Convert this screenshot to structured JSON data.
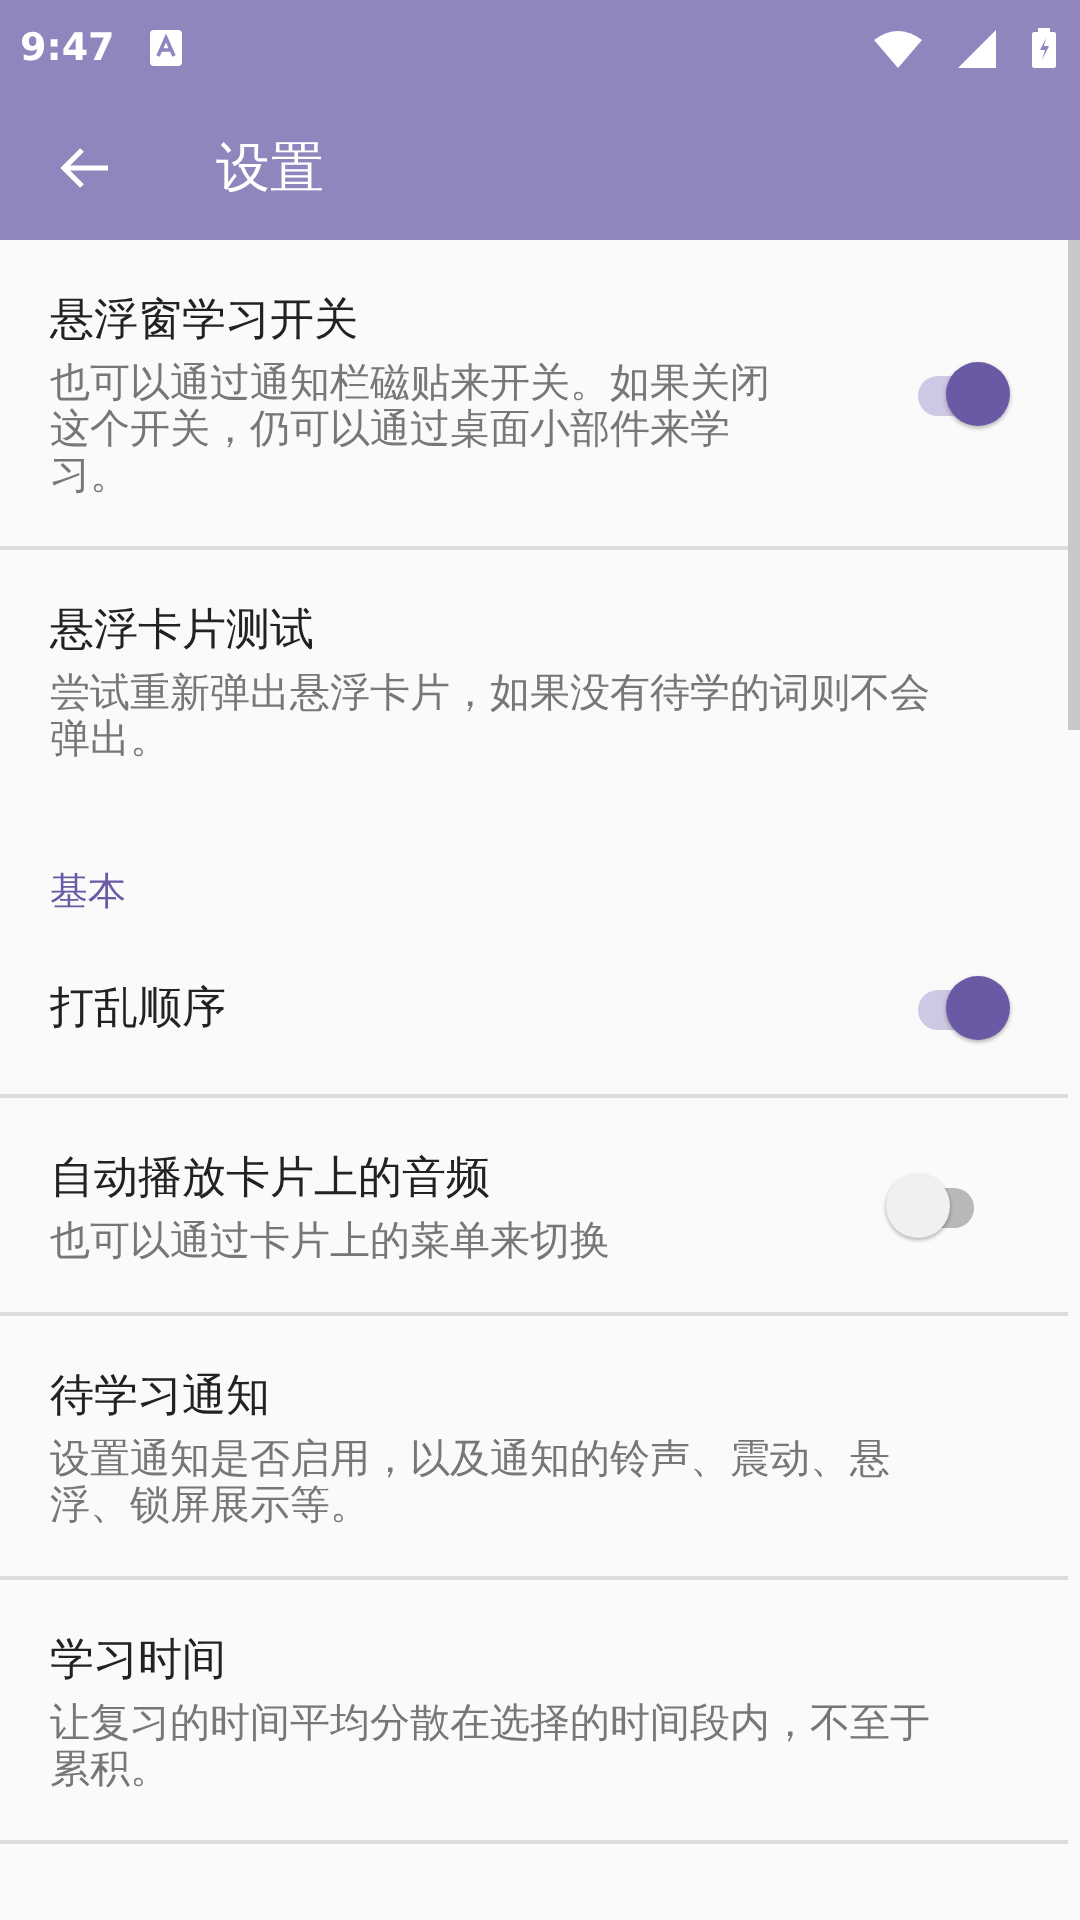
{
  "status_bar": {
    "time": "9:47"
  },
  "app_bar": {
    "title": "设置"
  },
  "items": [
    {
      "kind": "switch",
      "title": "悬浮窗学习开关",
      "summary": "也可以通过通知栏磁贴来开关。如果关闭这个开关，仍可以通过桌面小部件来学习。",
      "on": true
    },
    {
      "kind": "plain",
      "title": "悬浮卡片测试",
      "summary": "尝试重新弹出悬浮卡片，如果没有待学的词则不会弹出。"
    },
    {
      "kind": "category",
      "title": "基本"
    },
    {
      "kind": "switch",
      "title": "打乱顺序",
      "on": true
    },
    {
      "kind": "switch",
      "title": "自动播放卡片上的音频",
      "summary": "也可以通过卡片上的菜单来切换",
      "on": false
    },
    {
      "kind": "plain",
      "title": "待学习通知",
      "summary": "设置通知是否启用，以及通知的铃声、震动、悬浮、锁屏展示等。"
    },
    {
      "kind": "plain",
      "title": "学习时间",
      "summary": "让复习的时间平均分散在选择的时间段内，不至于累积。"
    }
  ]
}
